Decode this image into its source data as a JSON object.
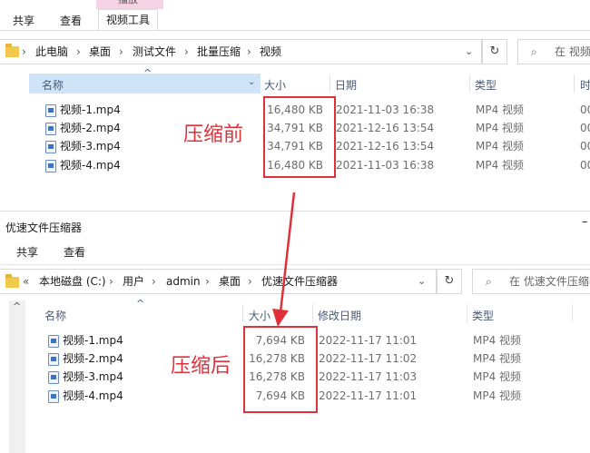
{
  "top_window": {
    "ribbon": {
      "tab_share": "共享",
      "tab_view": "查看",
      "tab_video_tools": "视频工具",
      "tab_play": "播放"
    },
    "breadcrumb": [
      "此电脑",
      "桌面",
      "测试文件",
      "批量压缩",
      "视频"
    ],
    "search_placeholder": "在 视频",
    "columns": {
      "name": "名称",
      "size": "大小",
      "date": "日期",
      "type": "类型",
      "extra": "时"
    },
    "files": [
      {
        "name": "视频-1.mp4",
        "size": "16,480 KB",
        "date": "2021-11-03 16:38",
        "type": "MP4 视频",
        "extra": "00"
      },
      {
        "name": "视频-2.mp4",
        "size": "34,791 KB",
        "date": "2021-12-16 13:54",
        "type": "MP4 视频",
        "extra": "00"
      },
      {
        "name": "视频-3.mp4",
        "size": "34,791 KB",
        "date": "2021-12-16 13:54",
        "type": "MP4 视频",
        "extra": "00"
      },
      {
        "name": "视频-4.mp4",
        "size": "16,480 KB",
        "date": "2021-11-03 16:38",
        "type": "MP4 视频",
        "extra": "00"
      }
    ],
    "annotation": "压缩前"
  },
  "bottom_window": {
    "title": "优速文件压缩器",
    "title_right": "–",
    "ribbon": {
      "tab_share": "共享",
      "tab_view": "查看"
    },
    "breadcrumb_prefix": "«",
    "breadcrumb": [
      "本地磁盘 (C:)",
      "用户",
      "admin",
      "桌面",
      "优速文件压缩器"
    ],
    "search_placeholder": "在 优速文件压缩器",
    "columns": {
      "name": "名称",
      "size": "大小",
      "date": "修改日期",
      "type": "类型"
    },
    "files": [
      {
        "name": "视频-1.mp4",
        "size": "7,694 KB",
        "date": "2022-11-17 11:01",
        "type": "MP4 视频"
      },
      {
        "name": "视频-2.mp4",
        "size": "16,278 KB",
        "date": "2022-11-17 11:02",
        "type": "MP4 视频"
      },
      {
        "name": "视频-3.mp4",
        "size": "16,278 KB",
        "date": "2022-11-17 11:03",
        "type": "MP4 视频"
      },
      {
        "name": "视频-4.mp4",
        "size": "7,694 KB",
        "date": "2022-11-17 11:01",
        "type": "MP4 视频"
      }
    ],
    "annotation": "压缩后"
  },
  "icons": {
    "refresh": "refresh-icon",
    "dropdown": "chevron-down-icon",
    "search": "search-icon",
    "sort": "sort-up-icon",
    "scroll_up": "scroll-up-icon"
  },
  "colors": {
    "annotation_red": "#e0313a",
    "header_selected": "#cfe4f7",
    "ribbon_pink": "#f7d2e5",
    "folder_yellow": "#f2c94c"
  }
}
